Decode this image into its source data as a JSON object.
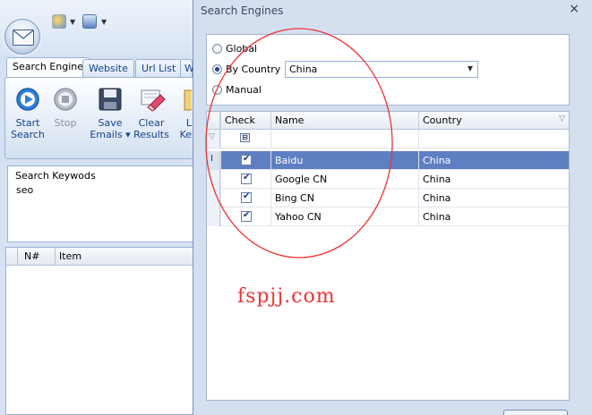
{
  "app": {
    "tabs": [
      "Search Engine",
      "Website",
      "Url List",
      "W"
    ],
    "ribbon_buttons": [
      {
        "line1": "Start",
        "line2": "Search",
        "icon": "play-icon"
      },
      {
        "line1": "Stop",
        "line2": "",
        "icon": "stop-icon"
      },
      {
        "line1": "Save",
        "line2": "Emails ▾",
        "icon": "floppy-disk-icon"
      },
      {
        "line1": "Clear",
        "line2": "Results",
        "icon": "eraser-icon"
      },
      {
        "line1": "L",
        "line2": "Ke",
        "icon": "partial-icon"
      }
    ],
    "keywords_label": "Search Keywods",
    "keywords_value": "seo",
    "item_grid": {
      "columns": [
        "N#",
        "Item"
      ]
    }
  },
  "dialog": {
    "title": "Search Engines",
    "close": "×",
    "options": [
      "Global",
      "By Country",
      "Manual"
    ],
    "selected_option": "By Country",
    "country": "China",
    "columns": [
      "Check",
      "Name",
      "Country"
    ],
    "rows": [
      {
        "checked": true,
        "name": "Baidu",
        "country": "China",
        "selected": true
      },
      {
        "checked": true,
        "name": "Google CN",
        "country": "China",
        "selected": false
      },
      {
        "checked": true,
        "name": "Bing CN",
        "country": "China",
        "selected": false
      },
      {
        "checked": true,
        "name": "Yahoo CN",
        "country": "China",
        "selected": false
      }
    ]
  },
  "watermark": "fspjj.com",
  "colors": {
    "selected_row": "#5f7fc3",
    "annotation": "#e33333"
  }
}
